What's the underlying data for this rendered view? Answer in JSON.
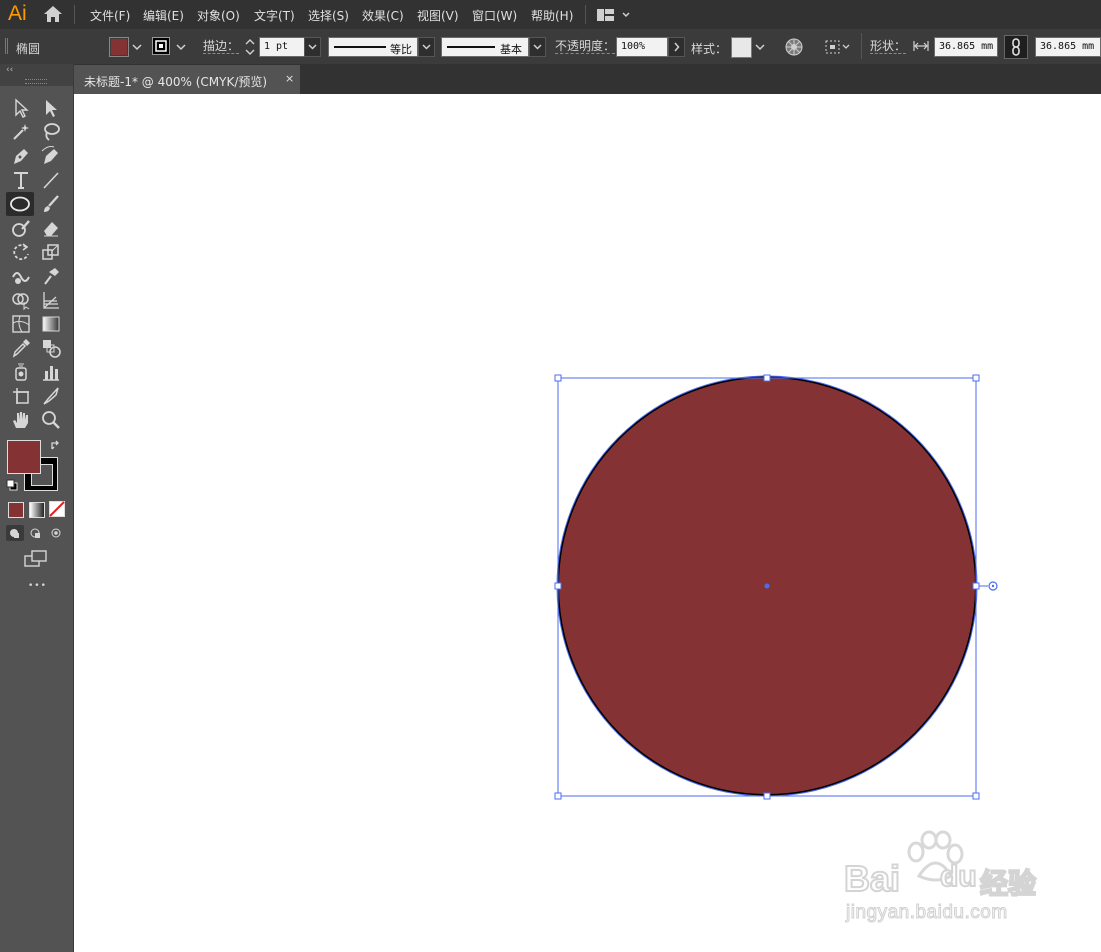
{
  "app": {
    "logo": "Ai"
  },
  "menu": [
    "文件(F)",
    "编辑(E)",
    "对象(O)",
    "文字(T)",
    "选择(S)",
    "效果(C)",
    "视图(V)",
    "窗口(W)",
    "帮助(H)"
  ],
  "control_bar": {
    "object_type": "椭圆",
    "fill_color": "#853235",
    "stroke_label": "描边：",
    "stroke_weight": "1 pt",
    "variable_width_profile": "等比",
    "brush_definition": "基本",
    "opacity_label": "不透明度：",
    "opacity_value": "100%",
    "style_label": "样式：",
    "shape_label": "形状：",
    "width_value": "36.865 mm",
    "height_value": "36.865 mm"
  },
  "document_tab": {
    "title": "未标题-1* @ 400% (CMYK/预览)",
    "close": "×"
  },
  "toolbar": {
    "collapse": "‹‹",
    "more": "•••",
    "fill_color": "#853235",
    "stroke_color": "#000000"
  },
  "canvas": {
    "shape": "ellipse",
    "fill_color": "#853235",
    "stroke_color": "#000000",
    "selection_color": "#4a6cf0"
  },
  "watermark": {
    "brand": "Bai",
    "brand2": "du",
    "product": "经验",
    "url": "jingyan.baidu.com"
  },
  "colors": {
    "accent": "#ff9a00",
    "ui_dark": "#323232",
    "ui_mid": "#535353"
  }
}
